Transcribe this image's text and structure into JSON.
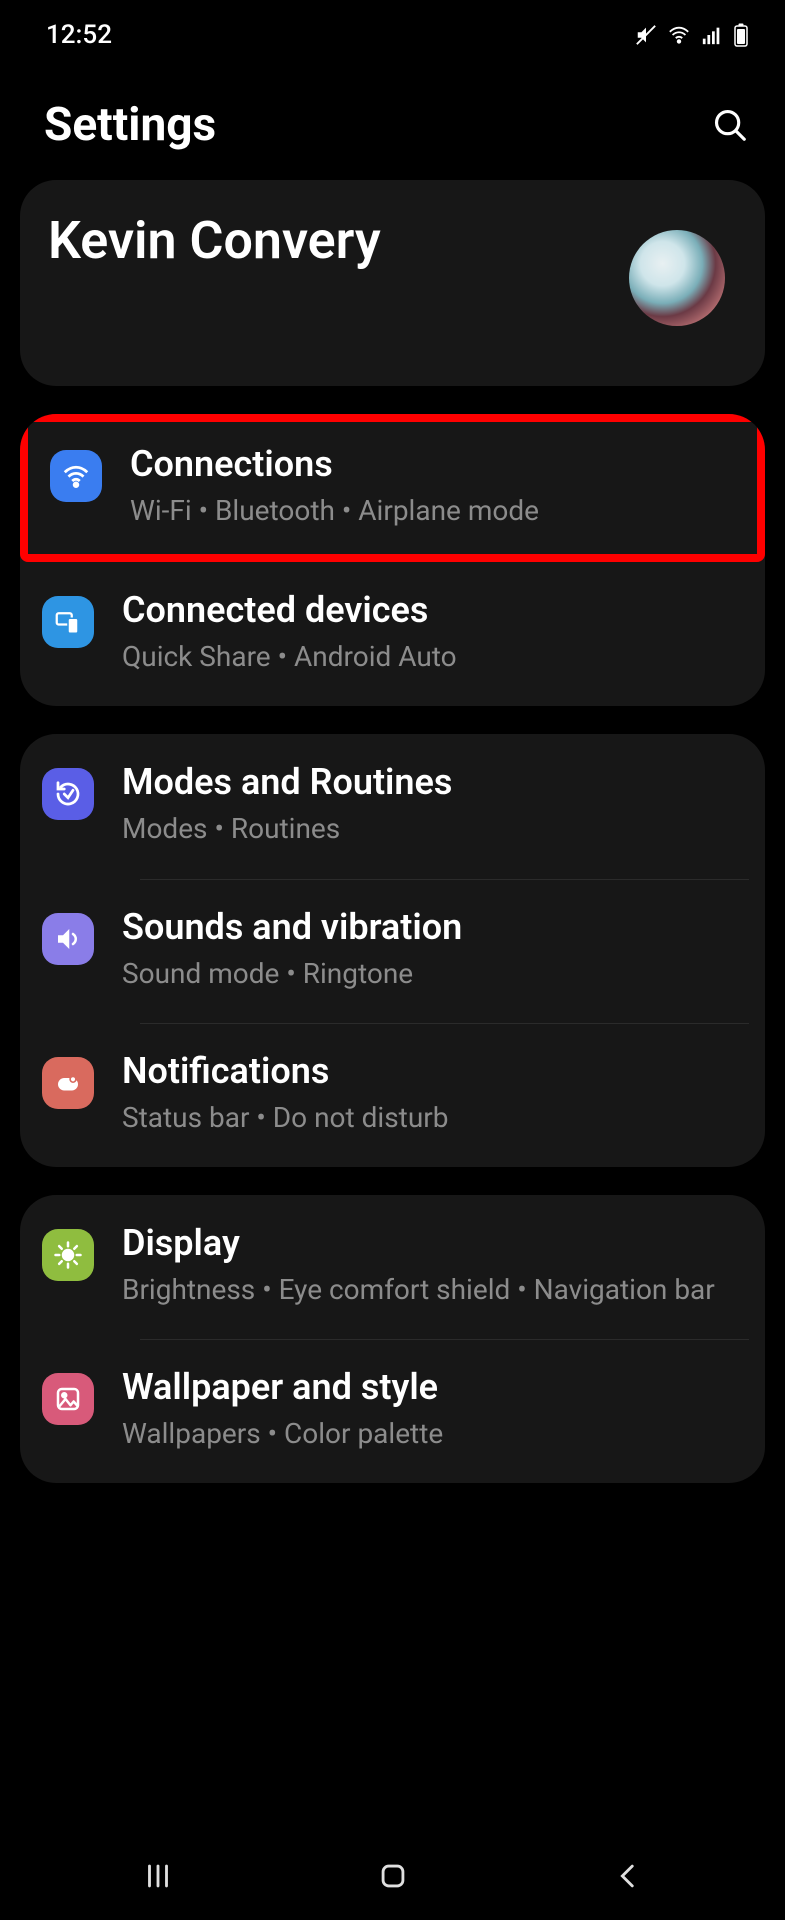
{
  "status": {
    "time": "12:52"
  },
  "header": {
    "title": "Settings"
  },
  "profile": {
    "name": "Kevin Convery"
  },
  "groups": [
    {
      "items": [
        {
          "title": "Connections",
          "sub": "Wi‑Fi  •  Bluetooth  •  Airplane mode"
        },
        {
          "title": "Connected devices",
          "sub": "Quick Share  •  Android Auto"
        }
      ]
    },
    {
      "items": [
        {
          "title": "Modes and Routines",
          "sub": "Modes  •  Routines"
        },
        {
          "title": "Sounds and vibration",
          "sub": "Sound mode  •  Ringtone"
        },
        {
          "title": "Notifications",
          "sub": "Status bar  •  Do not disturb"
        }
      ]
    },
    {
      "items": [
        {
          "title": "Display",
          "sub": "Brightness  •  Eye comfort shield  •  Navigation bar"
        },
        {
          "title": "Wallpaper and style",
          "sub": "Wallpapers  •  Color palette"
        }
      ]
    }
  ]
}
